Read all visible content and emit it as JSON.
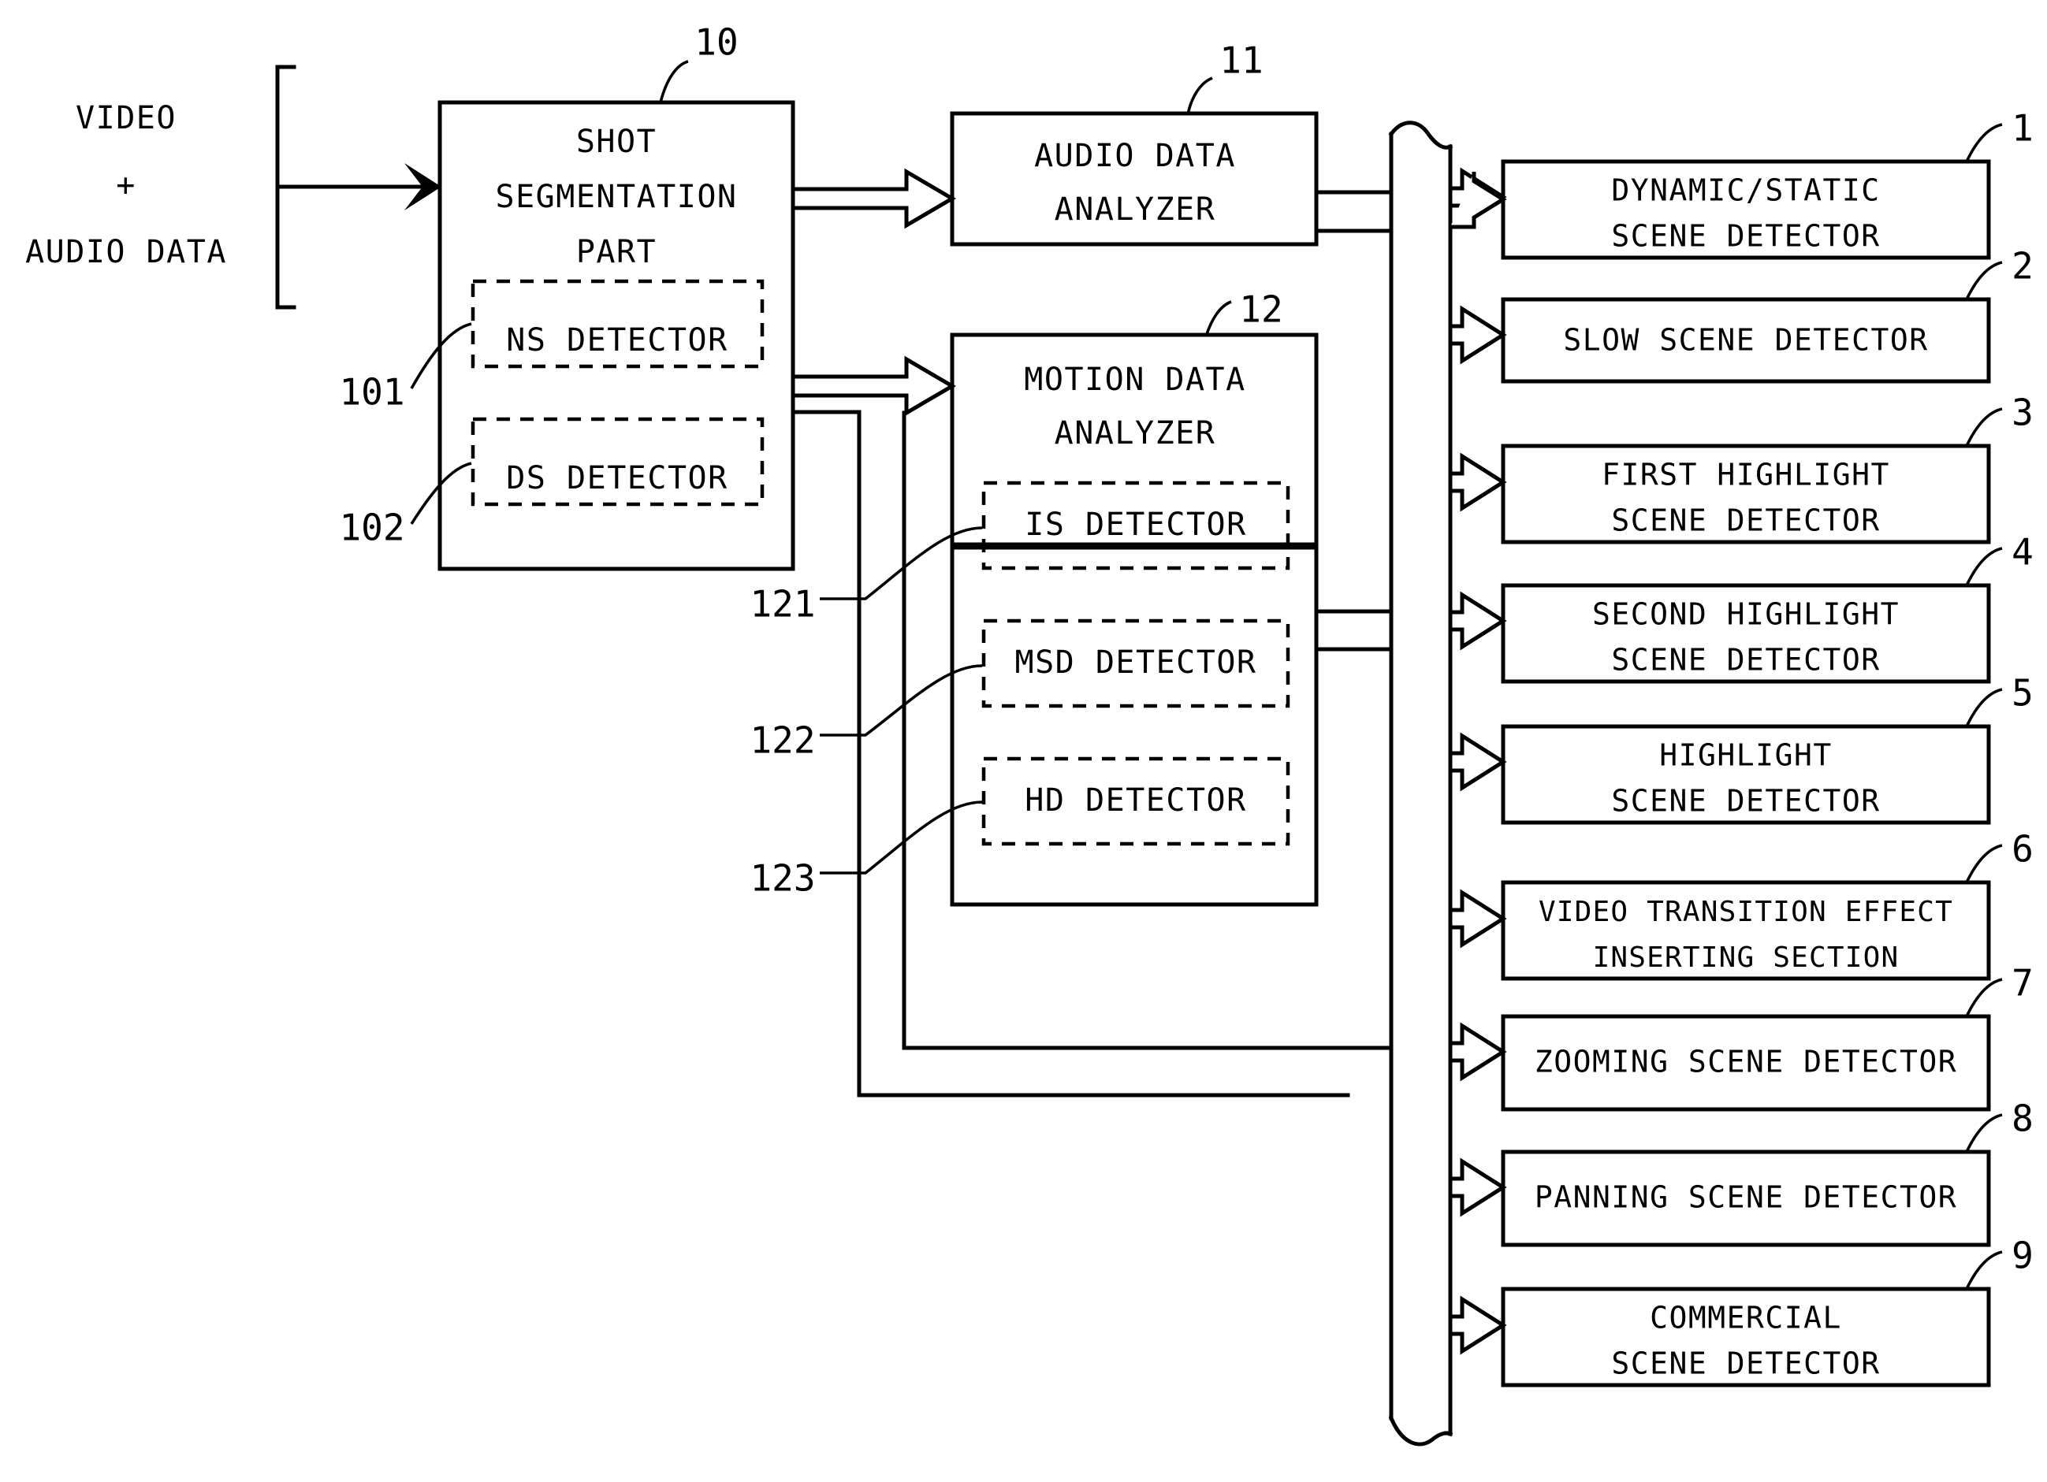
{
  "figure": {
    "type": "patent-block-diagram",
    "input_label_lines": [
      "VIDEO",
      "+",
      "AUDIO DATA"
    ]
  },
  "blocks": {
    "shot_segmentation": {
      "ref": "10",
      "title_lines": [
        "SHOT",
        "SEGMENTATION",
        "PART"
      ],
      "sub_blocks": [
        {
          "ref": "101",
          "label": "NS DETECTOR"
        },
        {
          "ref": "102",
          "label": "DS DETECTOR"
        }
      ]
    },
    "audio_data_analyzer": {
      "ref": "11",
      "title_lines": [
        "AUDIO DATA",
        "ANALYZER"
      ]
    },
    "motion_data_analyzer": {
      "ref": "12",
      "title_lines": [
        "MOTION DATA",
        "ANALYZER"
      ],
      "sub_blocks": [
        {
          "ref": "121",
          "label": "IS DETECTOR"
        },
        {
          "ref": "122",
          "label": "MSD DETECTOR"
        },
        {
          "ref": "123",
          "label": "HD DETECTOR"
        }
      ]
    }
  },
  "detectors": [
    {
      "ref": "1",
      "lines": [
        "DYNAMIC/STATIC",
        "SCENE DETECTOR"
      ]
    },
    {
      "ref": "2",
      "lines": [
        "SLOW SCENE DETECTOR"
      ]
    },
    {
      "ref": "3",
      "lines": [
        "FIRST HIGHLIGHT",
        "SCENE DETECTOR"
      ]
    },
    {
      "ref": "4",
      "lines": [
        "SECOND HIGHLIGHT",
        "SCENE DETECTOR"
      ]
    },
    {
      "ref": "5",
      "lines": [
        "HIGHLIGHT",
        "SCENE DETECTOR"
      ]
    },
    {
      "ref": "6",
      "lines": [
        "VIDEO TRANSITION EFFECT",
        "INSERTING SECTION"
      ]
    },
    {
      "ref": "7",
      "lines": [
        "ZOOMING SCENE DETECTOR"
      ]
    },
    {
      "ref": "8",
      "lines": [
        "PANNING SCENE DETECTOR"
      ]
    },
    {
      "ref": "9",
      "lines": [
        "COMMERCIAL",
        "SCENE DETECTOR"
      ]
    }
  ],
  "colors": {
    "line": "#000000",
    "background": "#ffffff"
  }
}
